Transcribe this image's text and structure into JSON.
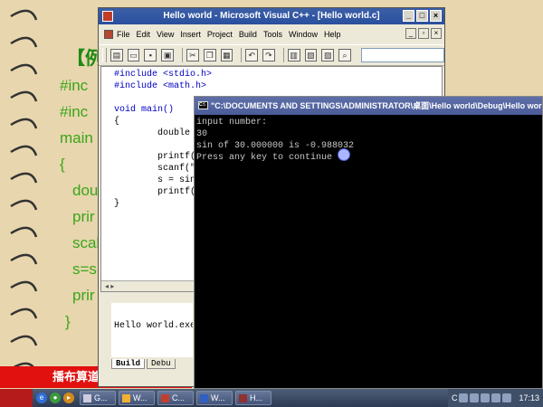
{
  "slide": {
    "heading": "【例",
    "code_fragments": [
      "#inc",
      "#inc",
      "main",
      "{",
      "dou",
      "prir",
      "scal",
      "s=s",
      "prir",
      "}"
    ],
    "banner_text": "播布算道"
  },
  "vc": {
    "title": "Hello world - Microsoft Visual C++ - [Hello world.c]",
    "menu": [
      "File",
      "Edit",
      "View",
      "Insert",
      "Project",
      "Build",
      "Tools",
      "Window",
      "Help"
    ],
    "code": [
      "#include <stdio.h>",
      "#include <math.h>",
      "",
      "void main()",
      "{",
      "        double x, s;",
      "",
      "        printf(\"input number:\\n\");",
      "        scanf(\"%lf\", &x);",
      "        s = sin(x);",
      "        printf(\"sin of %lf is %lf\\n\", x, s);",
      "}"
    ],
    "output_text": "Hello world.exe",
    "output_tabs": [
      "Build",
      "Debu"
    ]
  },
  "console": {
    "title": "\"C:\\DOCUMENTS AND SETTINGS\\ADMINISTRATOR\\桌面\\Hello world\\Debug\\Hello world.e",
    "lines": [
      "input number:",
      "30",
      "sin of 30.000000 is -0.988032",
      "Press any key to continue"
    ]
  },
  "taskbar": {
    "start": "",
    "tasks": [
      "G...",
      "W...",
      "C...",
      "W...",
      "H..."
    ],
    "tray_label": "C",
    "clock": "17:13"
  },
  "colors": {
    "console_bg": "#000000",
    "console_text": "#c8c8c8",
    "slide_green": "#3aa61a",
    "banner_red": "#e0110f"
  }
}
